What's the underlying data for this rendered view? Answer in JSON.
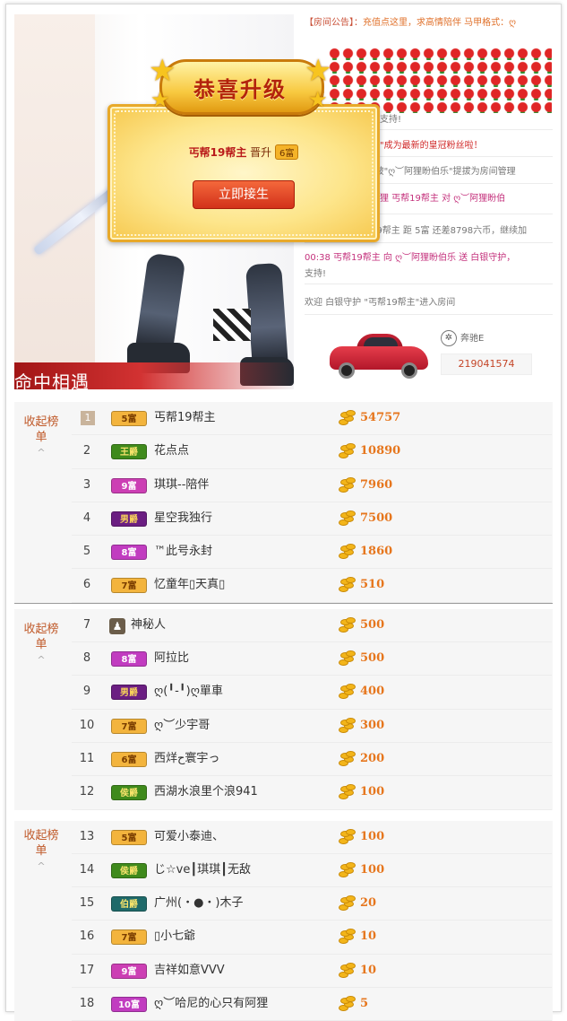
{
  "stage": {
    "banner_text": "命中相遇"
  },
  "popup": {
    "title": "恭喜升级",
    "user": "丐帮19帮主",
    "action": "晋升",
    "rank": "6富",
    "button": "立即接生"
  },
  "chat": {
    "notice_label": "【房间公告】：",
    "notice_text": "充值点这里，求高情陪伴 马甲格式：ღ",
    "lines": [
      "情支持!",
      "主\"成为最新的皇冠粉丝啦！",
      "\"被\"ღ︶阿狸盼伯乐\"提拔为房间管理",
      "迷狸   丐帮19帮主 对 ღ︶阿狸盼伯",
      "19帮主 距 5富 还差8798六币，继续加",
      "00:38  丐帮19帮主 向 ღ︶阿狸盼伯乐 送    白银守护，",
      "支持!",
      "欢迎    白银守护 \"丐帮19帮主\"进入房间"
    ],
    "car_brand": "奔驰E",
    "car_id": "219041574"
  },
  "groups": [
    {
      "collapse": "收起榜单",
      "chevron": "^",
      "rows": [
        {
          "rank": "1",
          "level": "5富",
          "level_color": "#f3b43d",
          "level_text": "#7a3d00",
          "name": "丐帮19帮主",
          "amount": "54757",
          "top": true
        },
        {
          "rank": "2",
          "level": "王爵",
          "level_color": "#3f8a1c",
          "level_text": "#f7e36b",
          "name": "花点点",
          "amount": "10890"
        },
        {
          "rank": "3",
          "level": "9富",
          "level_color": "#cc3fb4",
          "level_text": "#ffffff",
          "name": "琪琪--陪伴",
          "amount": "7960"
        },
        {
          "rank": "4",
          "level": "男爵",
          "level_color": "#6b1e82",
          "level_text": "#f7d25a",
          "name": "星空我独行",
          "amount": "7500"
        },
        {
          "rank": "5",
          "level": "8富",
          "level_color": "#c13cc0",
          "level_text": "#ffffff",
          "name": "™此号永封",
          "amount": "1860"
        },
        {
          "rank": "6",
          "level": "7富",
          "level_color": "#f3b43d",
          "level_text": "#7a3d00",
          "name": "忆童年▯天真▯",
          "amount": "510"
        }
      ]
    },
    {
      "collapse": "收起榜单",
      "chevron": "^",
      "rows": [
        {
          "rank": "7",
          "level": "",
          "mystery": true,
          "name": "神秘人",
          "amount": "500"
        },
        {
          "rank": "8",
          "level": "8富",
          "level_color": "#c13cc0",
          "level_text": "#ffffff",
          "name": "阿拉比",
          "amount": "500"
        },
        {
          "rank": "9",
          "level": "男爵",
          "level_color": "#6b1e82",
          "level_text": "#f7d25a",
          "name": "ღ(╹-╹)ღ單車",
          "amount": "400"
        },
        {
          "rank": "10",
          "level": "7富",
          "level_color": "#f3b43d",
          "level_text": "#7a3d00",
          "name": "ღ︶少宇哥",
          "amount": "300"
        },
        {
          "rank": "11",
          "level": "6富",
          "level_color": "#f3b43d",
          "level_text": "#7a3d00",
          "name": "西烊ح寰宇っ",
          "amount": "200"
        },
        {
          "rank": "12",
          "level": "侯爵",
          "level_color": "#3f8a1c",
          "level_text": "#f7e36b",
          "name": "西湖水浪里个浪941",
          "amount": "100"
        }
      ]
    },
    {
      "collapse": "收起榜单",
      "chevron": "^",
      "rows": [
        {
          "rank": "13",
          "level": "5富",
          "level_color": "#f3b43d",
          "level_text": "#7a3d00",
          "name": "可爱小泰迪、",
          "amount": "100"
        },
        {
          "rank": "14",
          "level": "侯爵",
          "level_color": "#3f8a1c",
          "level_text": "#f7e36b",
          "name": "じ☆ve┃琪琪┃无敌",
          "amount": "100"
        },
        {
          "rank": "15",
          "level": "伯爵",
          "level_color": "#1f6a6a",
          "level_text": "#f7e36b",
          "name": "广州(・●・)木子",
          "amount": "20"
        },
        {
          "rank": "16",
          "level": "7富",
          "level_color": "#f3b43d",
          "level_text": "#7a3d00",
          "name": "▯小七爺",
          "amount": "10"
        },
        {
          "rank": "17",
          "level": "9富",
          "level_color": "#cc3fb4",
          "level_text": "#ffffff",
          "name": "吉祥如意VVV",
          "amount": "10"
        },
        {
          "rank": "18",
          "level": "10富",
          "level_color": "#c13cc0",
          "level_text": "#ffffff",
          "name": "ღ︶哈尼的心只有阿狸",
          "amount": "5"
        }
      ]
    }
  ]
}
